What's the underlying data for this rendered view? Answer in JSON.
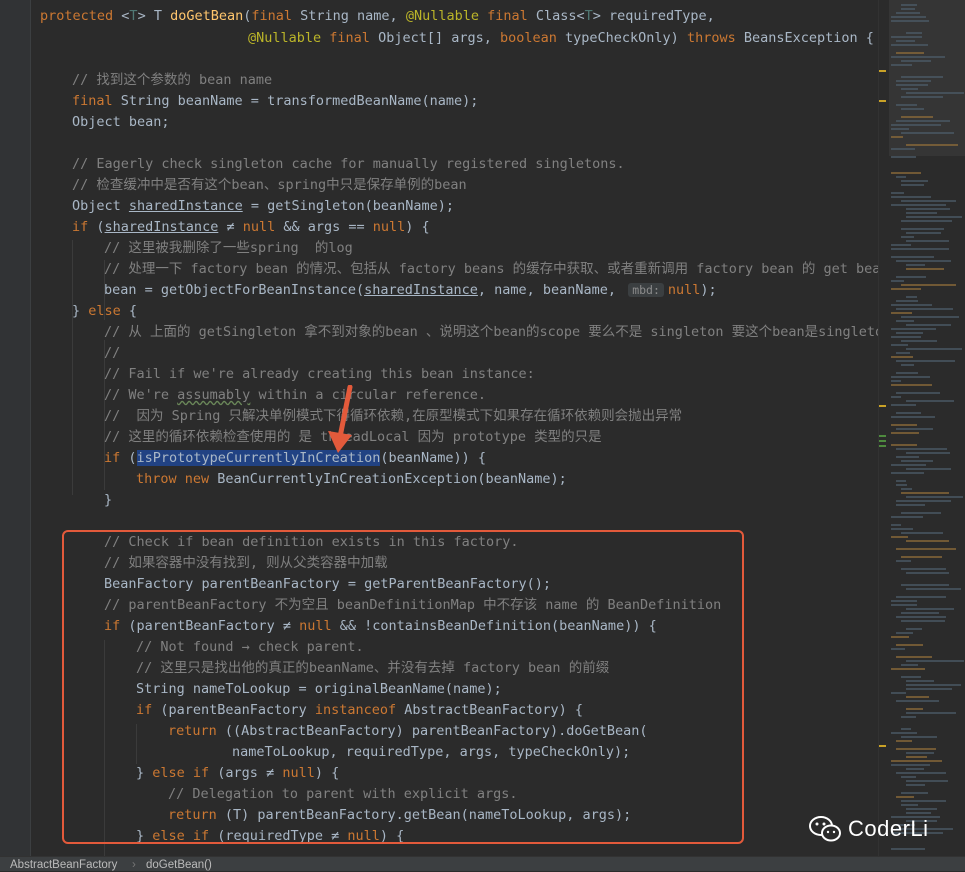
{
  "code": {
    "l0": {
      "kw1": "protected",
      "sp1": " <",
      "tp1": "T",
      "sp2": "> T ",
      "fn": "doGetBean",
      "p1": "(",
      "kw2": "final",
      "p2": " String name, ",
      "ann1": "@Nullable",
      "sp3": " ",
      "kw3": "final",
      "p3": " Class<",
      "tp2": "T",
      "p4": "> requiredType,"
    },
    "l1": {
      "ann": "@Nullable",
      "sp1": " ",
      "kw1": "final",
      "p1": " Object[] args, ",
      "kw2": "boolean",
      "p2": " typeCheckOnly) ",
      "kw3": "throws",
      "p3": " BeansException {"
    },
    "l3": "// 找到这个参数的 bean name",
    "l4": {
      "kw": "final",
      "rest": " String beanName = transformedBeanName(name);"
    },
    "l5": "Object bean;",
    "l7": "// Eagerly check singleton cache for manually registered singletons.",
    "l8": "// 检查缓冲中是否有这个bean、spring中只是保存单例的bean",
    "l9": {
      "a": "Object ",
      "b": "sharedInstance",
      "c": " = getSingleton(beanName);"
    },
    "l10": {
      "kw1": "if",
      "a": " (",
      "b": "sharedInstance",
      "c": " ≠ ",
      "kw2": "null",
      "d": " && args == ",
      "kw3": "null",
      "e": ") {"
    },
    "l11": "// 这里被我删除了一些spring  的log",
    "l12": "// 处理一下 factory bean 的情况、包括从 factory beans 的缓存中获取、或者重新调用 factory bean 的 get bean 方",
    "l13": {
      "a": "bean = getObjectForBeanInstance(",
      "b": "sharedInstance",
      "c": ", name, beanName, ",
      "hint": "mbd:",
      "kw": "null",
      "d": ");"
    },
    "l14": {
      "a": "} ",
      "kw": "else",
      "b": " {"
    },
    "l15": "// 从 上面的 getSingleton 拿不到对象的bean 、说明这个bean的scope 要么不是 singleton 要这个bean是singleton 但",
    "l16": "//",
    "l17": "// Fail if we're already creating this bean instance:",
    "l18": {
      "a": "// We're ",
      "b": "assumably",
      "c": " within a circular reference."
    },
    "l19": "//  因为 Spring 只解决单例模式下得循环依赖,在原型模式下如果存在循环依赖则会抛出异常",
    "l20": "// 这里的循环依赖检查使用的 是 threadLocal 因为 prototype 类型的只是",
    "l21": {
      "kw": "if",
      "a": " (",
      "b": "isPrototypeCurrentlyInCreation",
      "c": "(beanName)) {"
    },
    "l22": {
      "kw1": "throw",
      "a": " ",
      "kw2": "new",
      "b": " BeanCurrentlyInCreationException(beanName);"
    },
    "l23": "}",
    "l25": "// Check if bean definition exists in this factory.",
    "l26": "// 如果容器中没有找到, 则从父类容器中加载",
    "l27": "BeanFactory parentBeanFactory = getParentBeanFactory();",
    "l28": "// parentBeanFactory 不为空且 beanDefinitionMap 中不存该 name 的 BeanDefinition",
    "l29": {
      "kw1": "if",
      "a": " (parentBeanFactory ≠ ",
      "kw2": "null",
      "b": " && !containsBeanDefinition(beanName)) {"
    },
    "l30": "// Not found → check parent.",
    "l31": "// 这里只是找出他的真正的beanName、并没有去掉 factory bean 的前缀",
    "l32": "String nameToLookup = originalBeanName(name);",
    "l33": {
      "kw1": "if",
      "a": " (parentBeanFactory ",
      "kw2": "instanceof",
      "b": " AbstractBeanFactory) {"
    },
    "l34": {
      "kw": "return",
      "a": " ((AbstractBeanFactory) parentBeanFactory).doGetBean("
    },
    "l35": "nameToLookup, requiredType, args, typeCheckOnly);",
    "l36": {
      "a": "} ",
      "kw1": "else if",
      "b": " (args ≠ ",
      "kw2": "null",
      "c": ") {"
    },
    "l37": "// Delegation to parent with explicit args.",
    "l38": {
      "kw": "return",
      "a": " (T) parentBeanFactory.getBean(nameToLookup, args);"
    },
    "l39": {
      "a": "} ",
      "kw1": "else if",
      "b": " (requiredType ≠ ",
      "kw2": "null",
      "c": ") {"
    }
  },
  "breadcrumb": {
    "item1": "AbstractBeanFactory",
    "item2": "doGetBean()"
  },
  "watermark": {
    "text": "CoderLi",
    "icon": "wechat-icon"
  },
  "colors": {
    "keyword": "#cc7832",
    "comment": "#808080",
    "annotation": "#bbb529",
    "method": "#ffc66d",
    "text": "#a9b7c6",
    "highlight": "#214283",
    "redbox": "#e35a3b"
  }
}
